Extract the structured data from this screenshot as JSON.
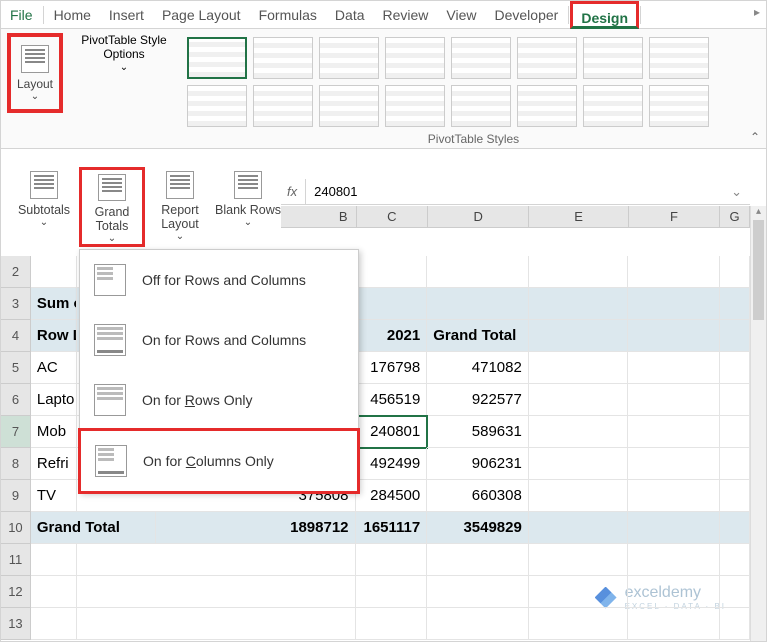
{
  "tabs": [
    "File",
    "Home",
    "Insert",
    "Page Layout",
    "Formulas",
    "Data",
    "Review",
    "View",
    "Developer",
    "Design"
  ],
  "ribbon": {
    "layout": "Layout",
    "pivot_options": "PivotTable Style Options",
    "styles_label": "PivotTable Styles"
  },
  "layout_menu": {
    "subtotals": "Subtotals",
    "grand_totals": "Grand Totals",
    "report_layout": "Report Layout",
    "blank_rows": "Blank Rows"
  },
  "grand_totals_menu": {
    "off": "Off for Rows and Columns",
    "on_both": "On for Rows and Columns",
    "rows_only_pre": "On for ",
    "rows_only_u": "R",
    "rows_only_post": "ows Only",
    "cols_only_pre": "On for ",
    "cols_only_u": "C",
    "cols_only_post": "olumns Only"
  },
  "formula_bar": {
    "fx": "fx",
    "value": "240801"
  },
  "col_headers": {
    "B": "B",
    "C": "C",
    "D": "D",
    "E": "E",
    "F": "F",
    "G": "G"
  },
  "rows": {
    "n2": "2",
    "n3": "3",
    "n4": "4",
    "n5": "5",
    "n6": "6",
    "n7": "7",
    "n8": "8",
    "n9": "9",
    "n10": "10",
    "n11": "11",
    "n12": "12",
    "n13": "13"
  },
  "pivot": {
    "sum_of": "Sum o",
    "row_labels": "Row L",
    "col_2021": "2021",
    "grand_total_col": "Grand Total",
    "rows_data": [
      {
        "label": "AC",
        "v2021": "176798",
        "gt": "471082"
      },
      {
        "label": "Lapto",
        "v2021": "456519",
        "gt": "922577"
      },
      {
        "label": "Mob",
        "v2021": "240801",
        "gt": "589631"
      },
      {
        "label": "Refri",
        "v2021": "492499",
        "gt": "906231"
      },
      {
        "label": "TV",
        "v2020": "375808",
        "v2021": "284500",
        "gt": "660308"
      }
    ],
    "grand_total_label": "Grand Total",
    "gt_2020": "1898712",
    "gt_2021": "1651117",
    "gt_all": "3549829"
  },
  "watermark": {
    "brand": "exceldemy",
    "sub": "EXCEL · DATA · BI"
  }
}
